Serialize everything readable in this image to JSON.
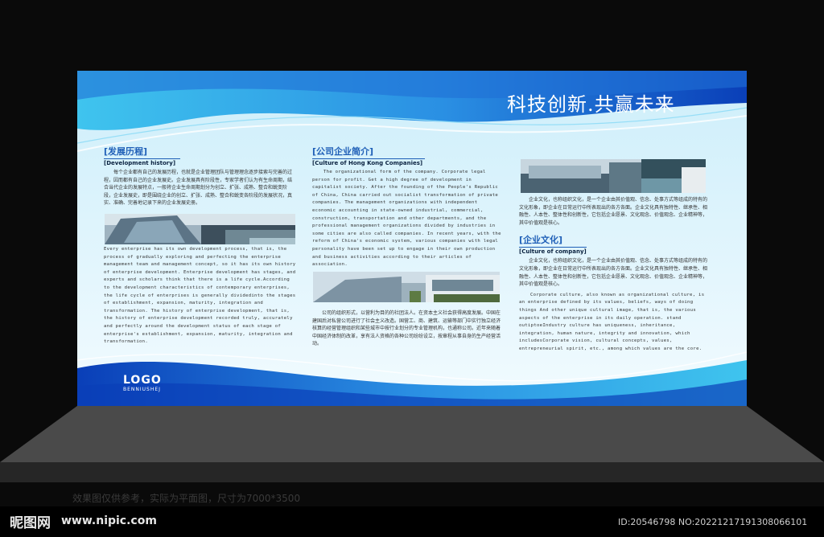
{
  "slogan": "科技创新.共赢未来",
  "history": {
    "title": "[发展历程]",
    "subtitle": "[Development history]",
    "body_cn": "每个企业都有自己的发展历程，也就是企业管理团队与管理理念逐步接索与完善的过程，因而都有自己的企业发展史。企业发展具有阶段性，专家学者们认为有生命周期，结合当代企业的发展特点，一般将企业生命周期划分为创立、扩张、成熟、整合和蜕变阶段，企业发展史，即是围绕企业的创立、扩张、成熟、整合和蜕变各阶段的发展状况，真实、准确、完善地记录下来的企业发展史册。",
    "body_en": "Every enterprise has its own development process, that is, the process of gradually exploring and perfecting the enterprise management team and management concept, so it has its own history of enterprise development. Enterprise development has stages, and experts and scholars think that there is a life cycle.According to the development characteristics of contemporary enterprises, the life cycle of enterprises is generally dividedinto the stages of establishment, expansion, maturity, integration and transformation. The history of enterprise development, that is, the history of enterprise development recorded truly, accurately and perfectly around the development status of each stage of enterprise's establishment, expansion, maturity, integration and transformation."
  },
  "company": {
    "title": "[公司企业简介]",
    "subtitle": "[Culture of Hong Kong Companies]",
    "body_en": "The organizational form of the company. Corporate legal person for profit. Get a high degree of development in capitalist society. After the founding of the People's Republic of China, China carried out socialist transformation of private companies. The management organizations with independent economic accounting in state-owned industrial, commercial, construction, transportation and other departments, and the professional management organizations divided by industries in some cities are also called companies. In recent years, with the reform of China's economic system, various companies with legal personality have been set up to engage in their own production and business activities according to their articles of association.",
    "body_cn": "公司的组织形式，以营利为目的的社团法人。在资本主义社会获得高度发展。中国在建国后对私营公司进行了社会主义改造。国营工、商、建筑、运输等部门中实行独立经济核算的经营管理组织和某些城市中按行业划分的专业管理机构，也通称公司。近年来随着中国经济体制的改革，享有法人资格的各种公司纷纷设立，按章程从事自身的生产经营活动。"
  },
  "culture": {
    "intro_cn": "企业文化，也称组织文化，是一个企业由其价值观、信念、处事方式等组成的特有的文化形象，即企业在日常运行中所表现出的各方各面。企业文化具有独特性、继承性、相融性、人本性、整体性和创新性，它包括企业愿景、文化观念、价值观念、企业精神等，其中价值观是核心。",
    "title": "[企业文化]",
    "subtitle": "[Culture of company]",
    "body_cn": "企业文化，也称组织文化，是一个企业由其价值观、信念、处事方式等组成的特有的文化形象，即企业在日常运行中所表现出的各方各面。企业文化具有独特性、继承性、相融性、人本性、整体性和创新性，它包括企业愿景、文化观念、价值观念、企业精神等，其中价值观是核心。",
    "body_en": "Corporate culture, also known as organizational culture, is an enterprise defined by its values, beliefs, ways of doing things And other unique cultural image, that is, the various aspects of the enterprise in its daily operation. stand outiptoeIndustry culture has uniqueness, inheritance, integration, human nature, integrity and innovation, which includesCorporate vision, cultural concepts, values, entrepreneurial spirit, etc., among which values are the core."
  },
  "logo": {
    "line1": "LOGO",
    "line2": "BENNIUSHEJ"
  },
  "caption": "效果图仅供参考，实际为平面图，尺寸为7000*3500",
  "watermark": {
    "brand": "昵图网",
    "url": "www.nipic.com",
    "id": "ID:20546798 NO:20221217191308066101"
  },
  "colors": {
    "accent": "#1f5fb7",
    "deep_blue": "#0a3fb8",
    "sky": "#3fc4ee"
  }
}
